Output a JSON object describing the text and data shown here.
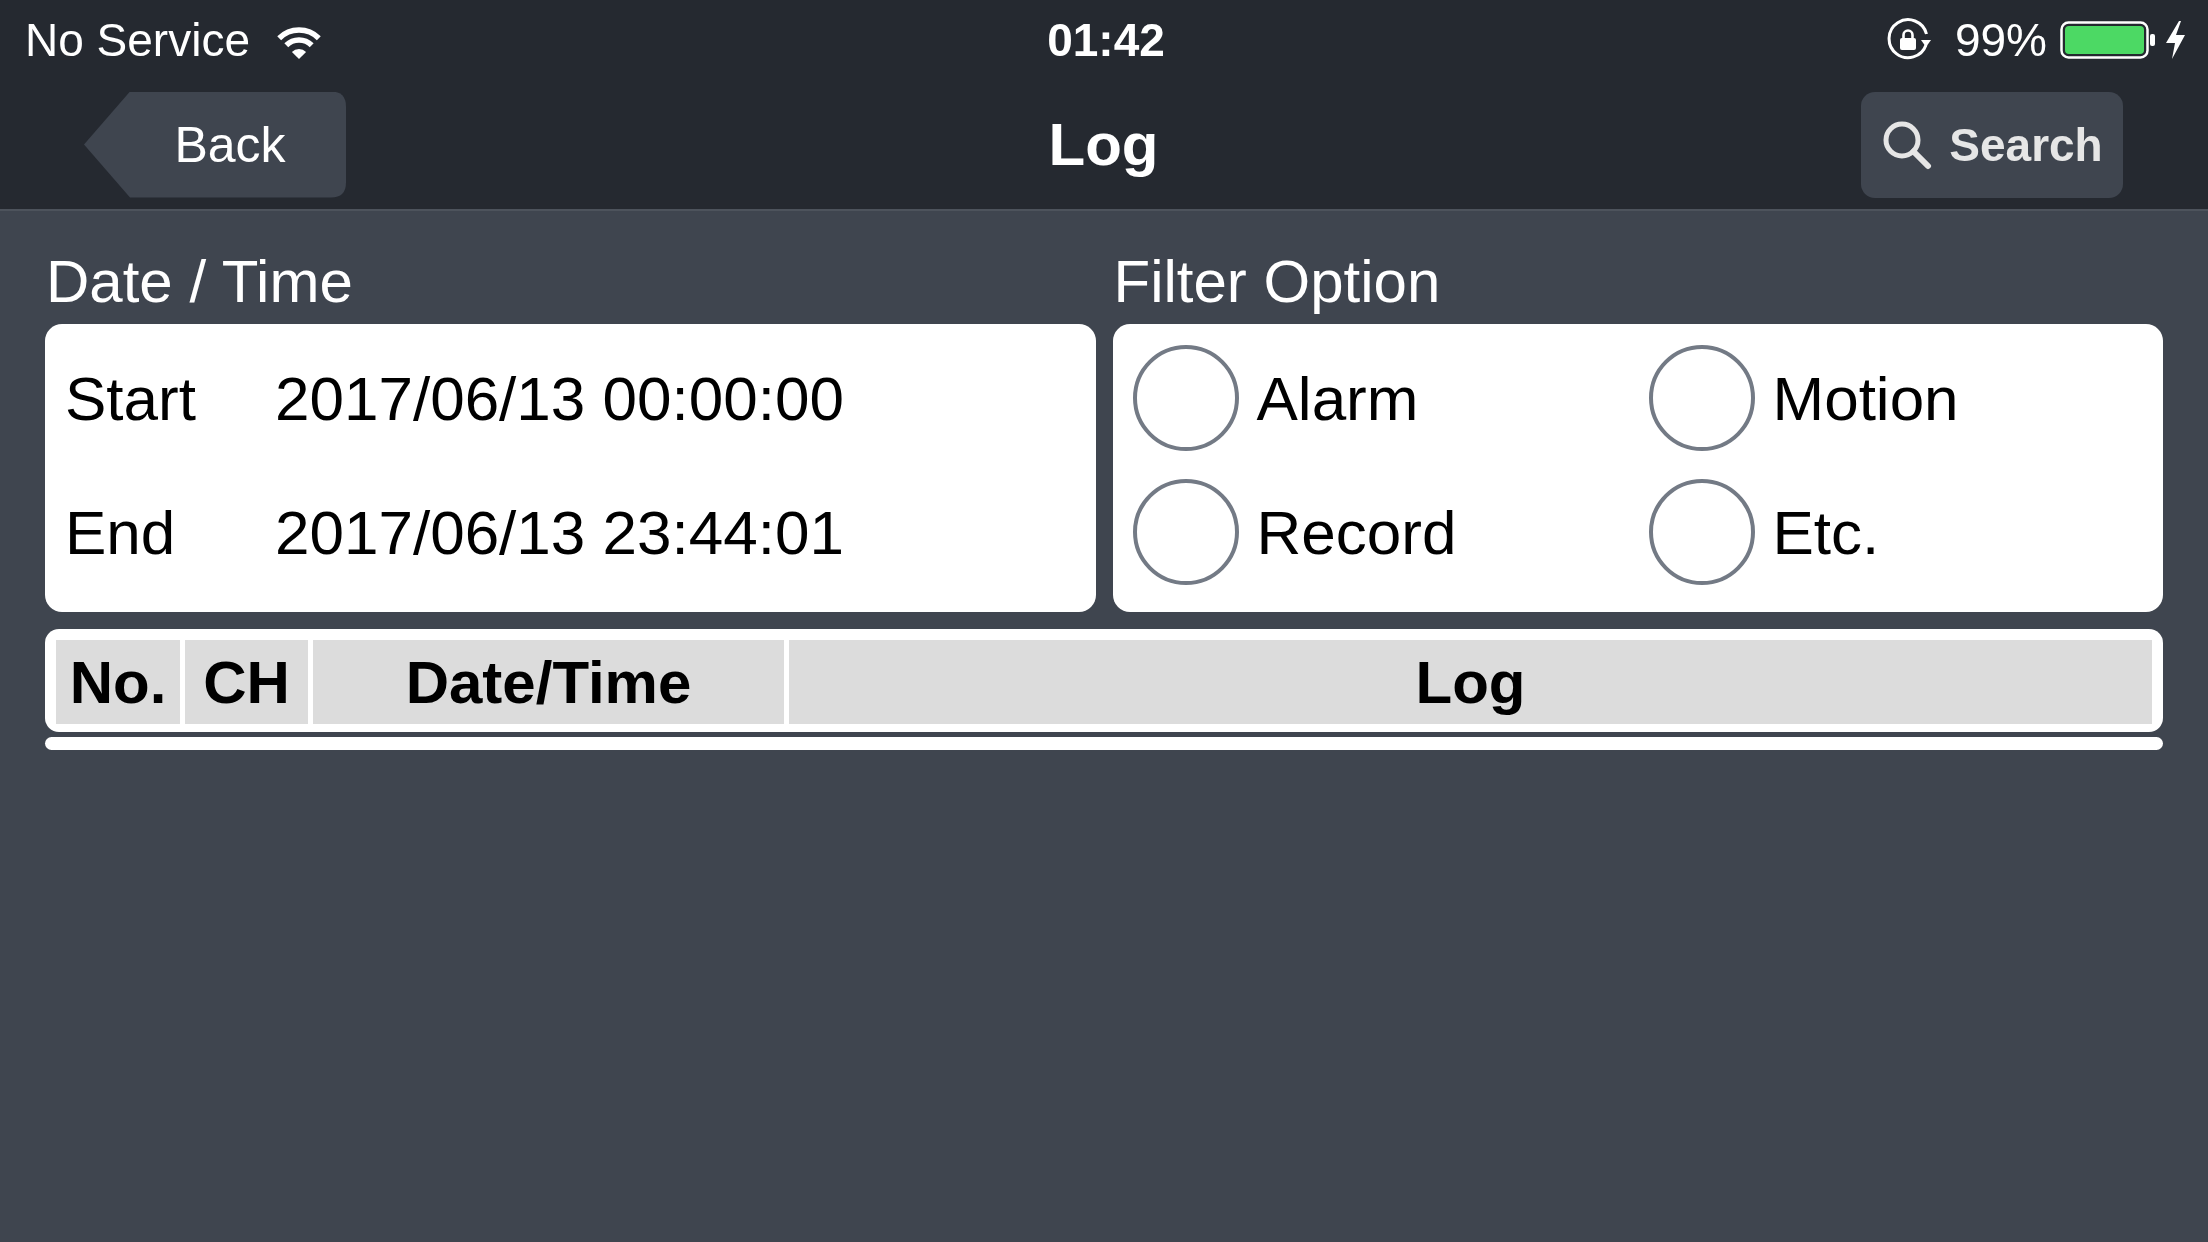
{
  "status_bar": {
    "carrier": "No Service",
    "time": "01:42",
    "battery": "99%"
  },
  "nav_bar": {
    "back_button": "Back",
    "title": "Log",
    "search_button": "Search"
  },
  "date_time": {
    "heading": "Date / Time",
    "rows": [
      {
        "label": "Start",
        "value": "2017/06/13 00:00:00"
      },
      {
        "label": "End",
        "value": "2017/06/13 23:44:01"
      }
    ]
  },
  "filter_option": {
    "heading": "Filter Option",
    "options": [
      {
        "label": "Alarm",
        "selected": false
      },
      {
        "label": "Motion",
        "selected": false
      },
      {
        "label": "Record",
        "selected": false
      },
      {
        "label": "Etc.",
        "selected": false
      }
    ]
  },
  "table": {
    "columns": [
      "No.",
      "CH",
      "Date/Time",
      "Log"
    ]
  }
}
